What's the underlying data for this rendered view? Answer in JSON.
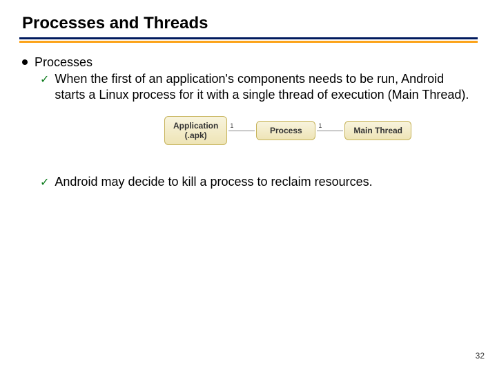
{
  "title": "Processes and Threads",
  "section": {
    "heading": "Processes",
    "sub1": "When the first of an application's components needs to be run, Android starts a Linux process for it with a single thread of execution (Main Thread).",
    "sub2": "Android may decide to kill a process to reclaim resources."
  },
  "diagram": {
    "box1_line1": "Application",
    "box1_line2": "(.apk)",
    "card1": "1",
    "box2": "Process",
    "card2": "1",
    "box3": "Main Thread"
  },
  "pageNumber": "32"
}
